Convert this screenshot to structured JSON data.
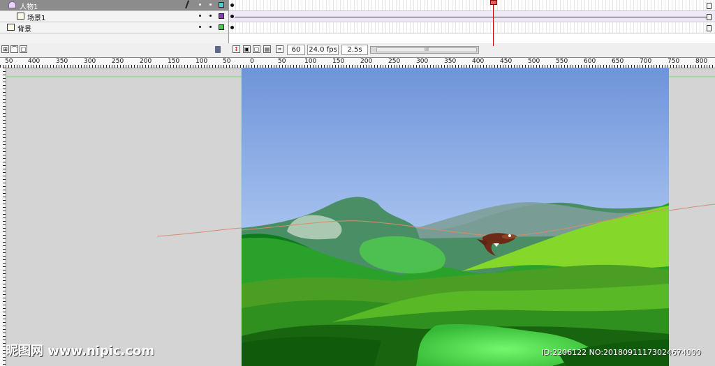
{
  "layers": [
    {
      "name": "人物1",
      "color": "#43d1d1"
    },
    {
      "name": "场景1",
      "color": "#8b3ab8"
    },
    {
      "name": "背景",
      "color": "#48cc48"
    }
  ],
  "timeline": {
    "current_frame": "60",
    "frame_rate": "24.0 fps",
    "elapsed_time": "2.5s",
    "scroll_thumb": "III"
  },
  "ruler": {
    "top_labels": [
      "50",
      "400",
      "350",
      "300",
      "250",
      "200",
      "150",
      "100",
      "50",
      "0",
      "50",
      "100",
      "150",
      "200",
      "250",
      "300",
      "350",
      "400",
      "450",
      "500",
      "550",
      "600",
      "650",
      "700",
      "750",
      "800"
    ]
  },
  "watermark": {
    "site": "昵图网 www.nipic.com",
    "id": "ID:2206122 NO:20180911173024674000"
  },
  "icons": [
    "guide-layer-icon",
    "layer-icon",
    "pencil-icon",
    "trash-icon",
    "onion-skin-icon",
    "center-frame-icon",
    "scroll-left-icon"
  ]
}
